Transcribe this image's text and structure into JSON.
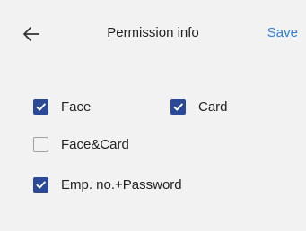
{
  "header": {
    "back_icon": "arrow-left-icon",
    "title": "Permission info",
    "save_label": "Save"
  },
  "colors": {
    "background": "#f2f2f2",
    "accent": "#2e7fd6",
    "checkbox_checked": "#2a4a98",
    "checkbox_unchecked_border": "#a3a3a3"
  },
  "options": [
    {
      "label": "Face",
      "checked": true
    },
    {
      "label": "Card",
      "checked": true
    },
    {
      "label": "Face&Card",
      "checked": false
    },
    {
      "label": "Emp. no.+Password",
      "checked": true
    }
  ]
}
